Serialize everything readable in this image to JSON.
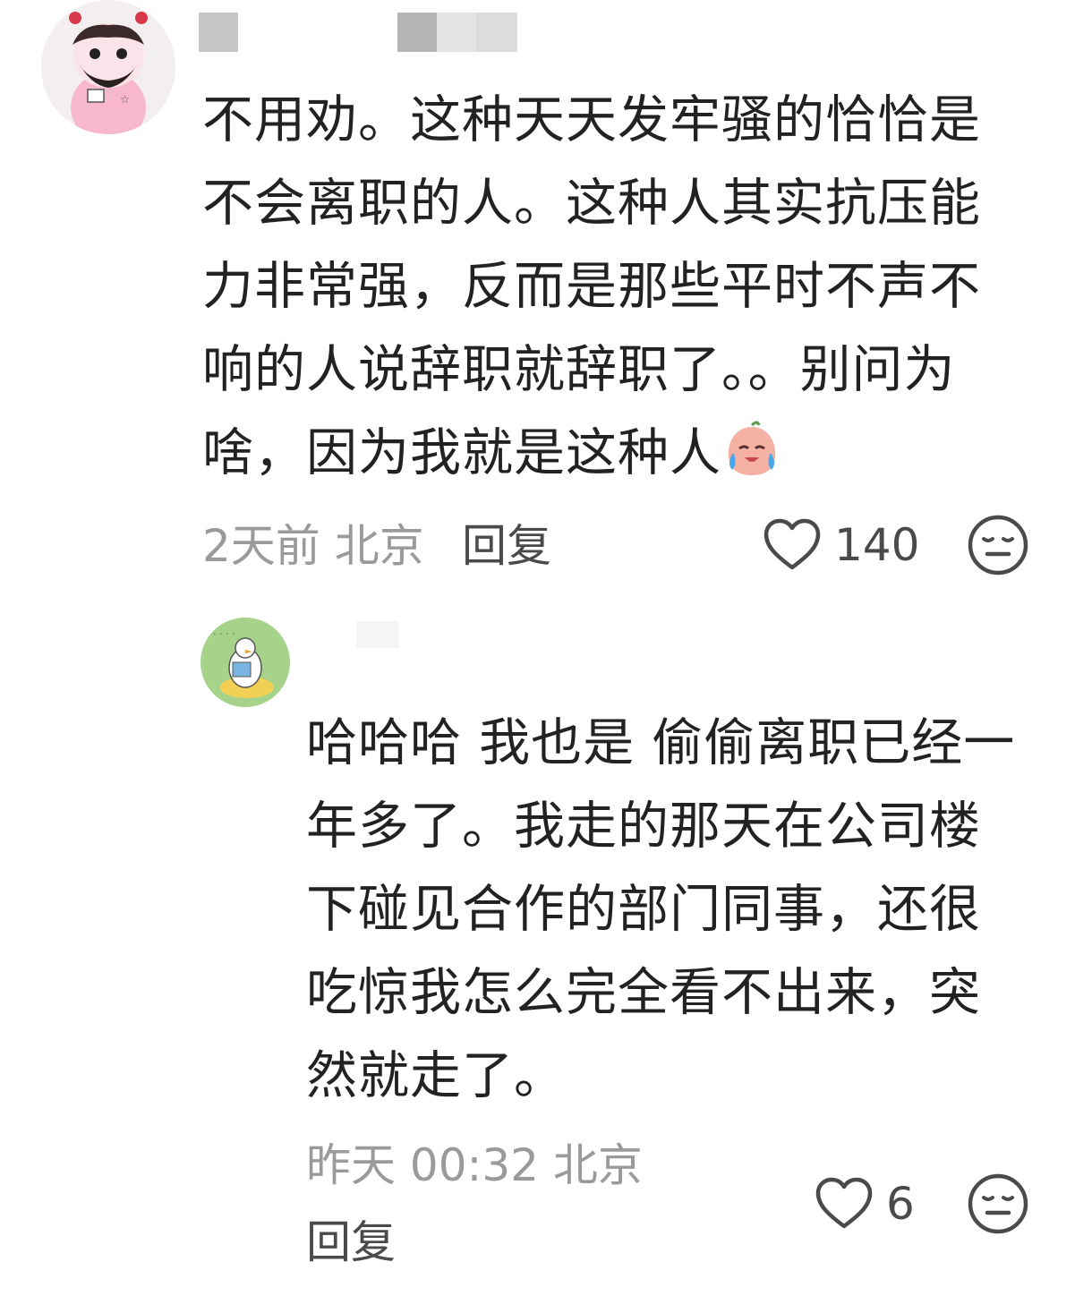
{
  "comments": [
    {
      "avatar": "cartoon-avatar-icon",
      "text": "不用劝。这种天天发牢骚的恰恰是\n不会离职的人。这种人其实抗压能\n力非常强，反而是那些平时不声不\n响的人说辞职就辞职了。。别问为\n啥，因为我就是这种人",
      "emoji": "crying-face-icon",
      "time": "2天前",
      "location": "北京",
      "reply_label": "回复",
      "likes": "140"
    },
    {
      "avatar": "duck-reading-avatar-icon",
      "text": "哈哈哈 我也是 偷偷离职已经一\n年多了。我走的那天在公司楼\n下碰见合作的部门同事，还很\n吃惊我怎么完全看不出来，突\n然就走了。",
      "time": "昨天 00:32",
      "location": "北京",
      "reply_label": "回复",
      "likes": "6"
    }
  ],
  "colors": {
    "text": "#222222",
    "meta": "#9a9a9a",
    "icon": "#4a4a4a",
    "name_blur": "#c8c8c8"
  }
}
